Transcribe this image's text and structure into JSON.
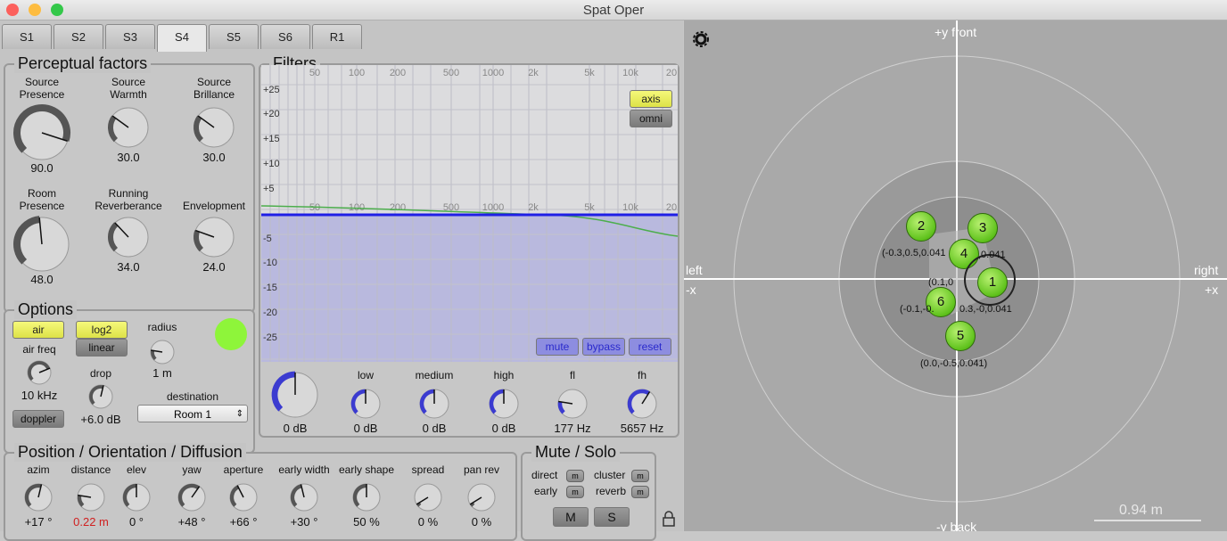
{
  "window": {
    "title": "Spat Oper"
  },
  "tabs": [
    "S1",
    "S2",
    "S3",
    "S4",
    "S5",
    "S6",
    "R1"
  ],
  "perceptual": {
    "title": "Perceptual factors",
    "knobs": [
      {
        "label": "Source\nPresence",
        "value": "90.0",
        "level": 0.9
      },
      {
        "label": "Source\nWarmth",
        "value": "30.0",
        "level": 0.3
      },
      {
        "label": "Source\nBrillance",
        "value": "30.0",
        "level": 0.3
      },
      {
        "label": "Room\nPresence",
        "value": "48.0",
        "level": 0.48
      },
      {
        "label": "Running\nReverberance",
        "value": "34.0",
        "level": 0.34
      },
      {
        "label": "Envelopment",
        "value": "24.0",
        "level": 0.24
      }
    ]
  },
  "filters": {
    "title": "Filters",
    "freq_labels": [
      "50",
      "100",
      "200",
      "500",
      "1000",
      "2k",
      "5k",
      "10k",
      "20"
    ],
    "db_labels": [
      "+25",
      "+20",
      "+15",
      "+10",
      "+5",
      "-5",
      "-10",
      "-15",
      "-20",
      "-25"
    ],
    "axis_label": "axis",
    "omni_label": "omni",
    "mute_label": "mute",
    "bypass_label": "bypass",
    "reset_label": "reset",
    "knobs": [
      {
        "label": "",
        "value": "0 dB",
        "level": 0.5
      },
      {
        "label": "low",
        "value": "0 dB",
        "level": 0.5
      },
      {
        "label": "medium",
        "value": "0 dB",
        "level": 0.5
      },
      {
        "label": "high",
        "value": "0 dB",
        "level": 0.5
      },
      {
        "label": "fl",
        "value": "177 Hz",
        "level": 0.2
      },
      {
        "label": "fh",
        "value": "5657 Hz",
        "level": 0.62
      }
    ]
  },
  "options": {
    "title": "Options",
    "air_label": "air",
    "log2_label": "log2",
    "linear_label": "linear",
    "radius_label": "radius",
    "radius_value": "1 m",
    "air_freq_label": "air freq",
    "air_freq_value": "10 kHz",
    "drop_label": "drop",
    "drop_value": "+6.0 dB",
    "destination_label": "destination",
    "destination_value": "Room 1",
    "doppler_label": "doppler",
    "indicator_color": "#8ef53a"
  },
  "position": {
    "title": "Position / Orientation / Diffusion",
    "knobs": [
      {
        "label": "azim",
        "value": "+17 °",
        "level": 0.55
      },
      {
        "label": "distance",
        "value": "0.22 m",
        "level": 0.2,
        "color": "#d02020"
      },
      {
        "label": "elev",
        "value": "0 °",
        "level": 0.5
      },
      {
        "label": "yaw",
        "value": "+48 °",
        "level": 0.63
      },
      {
        "label": "aperture",
        "value": "+66 °",
        "level": 0.4
      },
      {
        "label": "early width",
        "value": "+30 °",
        "level": 0.45
      },
      {
        "label": "early shape",
        "value": "50 %",
        "level": 0.5
      },
      {
        "label": "spread",
        "value": "0 %",
        "level": 0.05
      },
      {
        "label": "pan rev",
        "value": "0 %",
        "level": 0.05
      }
    ]
  },
  "mute_solo": {
    "title": "Mute / Solo",
    "direct_label": "direct",
    "early_label": "early",
    "cluster_label": "cluster",
    "reverb_label": "reverb",
    "m_small": "m",
    "m_label": "M",
    "s_label": "S"
  },
  "spatial": {
    "top_label": "+y front",
    "bottom_label": "-y back",
    "left_label": "left",
    "left_axis": "-x",
    "right_label": "right",
    "right_axis": "+x",
    "scale_label": "0.94 m",
    "sources": [
      {
        "id": "2",
        "coord": "(-0.3,0.5,0.041"
      },
      {
        "id": "3",
        "coord": ",0.041"
      },
      {
        "id": "4",
        "coord": ""
      },
      {
        "id": "1",
        "coord": ""
      },
      {
        "id": "6",
        "coord": "(-0.1,-0."
      },
      {
        "id": "5",
        "coord": "(0.0,-0.5,0.041)"
      }
    ],
    "extra_coords": [
      "(0.1,0",
      "0.3,-0,0.041"
    ]
  }
}
